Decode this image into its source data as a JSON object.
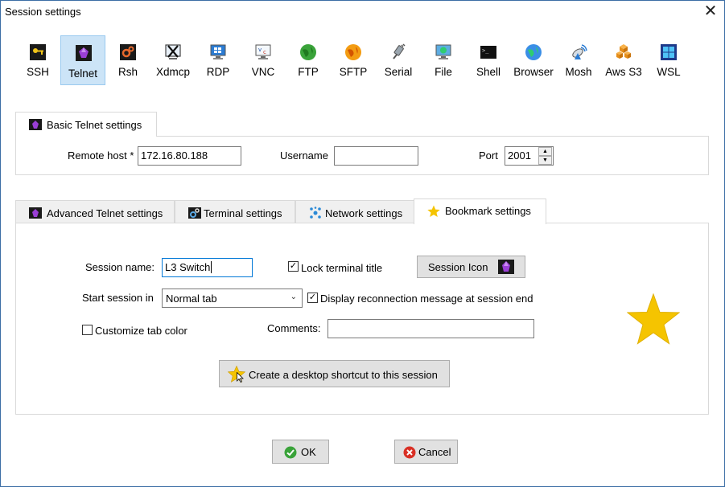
{
  "window": {
    "title": "Session settings",
    "close_glyph": "✕"
  },
  "protocols": [
    {
      "label": "SSH",
      "icon": "key-icon",
      "active": false
    },
    {
      "label": "Telnet",
      "icon": "telnet-gem-icon",
      "active": true
    },
    {
      "label": "Rsh",
      "icon": "rsh-gears-icon",
      "active": false
    },
    {
      "label": "Xdmcp",
      "icon": "xdmcp-x-icon",
      "active": false
    },
    {
      "label": "RDP",
      "icon": "rdp-monitor-icon",
      "active": false
    },
    {
      "label": "VNC",
      "icon": "vnc-monitor-icon",
      "active": false
    },
    {
      "label": "FTP",
      "icon": "ftp-globe-icon",
      "active": false
    },
    {
      "label": "SFTP",
      "icon": "sftp-globe-icon",
      "active": false
    },
    {
      "label": "Serial",
      "icon": "serial-plug-icon",
      "active": false
    },
    {
      "label": "File",
      "icon": "file-monitor-icon",
      "active": false
    },
    {
      "label": "Shell",
      "icon": "shell-terminal-icon",
      "active": false
    },
    {
      "label": "Browser",
      "icon": "browser-globe-icon",
      "active": false
    },
    {
      "label": "Mosh",
      "icon": "mosh-satellite-icon",
      "active": false
    },
    {
      "label": "Aws S3",
      "icon": "aws-cubes-icon",
      "active": false
    },
    {
      "label": "WSL",
      "icon": "windows-logo-icon",
      "active": false
    }
  ],
  "basic": {
    "tab_label": "Basic Telnet settings",
    "remote_host_label": "Remote host *",
    "remote_host_value": "172.16.80.188",
    "username_label": "Username",
    "username_value": "",
    "port_label": "Port",
    "port_value": "2001"
  },
  "tabs": [
    {
      "label": "Advanced Telnet settings",
      "selected": false
    },
    {
      "label": "Terminal settings",
      "selected": false
    },
    {
      "label": "Network settings",
      "selected": false
    },
    {
      "label": "Bookmark settings",
      "selected": true
    }
  ],
  "bookmark": {
    "session_name_label": "Session name:",
    "session_name_value": "L3 Switch",
    "lock_title_label": "Lock terminal title",
    "lock_title_checked": true,
    "session_icon_label": "Session Icon",
    "start_in_label": "Start session in",
    "start_in_value": "Normal tab",
    "reconnect_label": "Display reconnection message at session end",
    "reconnect_checked": true,
    "customize_color_label": "Customize tab color",
    "customize_color_checked": false,
    "comments_label": "Comments:",
    "comments_value": "",
    "shortcut_label": "Create a desktop shortcut to this session"
  },
  "footer": {
    "ok_label": "OK",
    "cancel_label": "Cancel"
  },
  "colors": {
    "accent": "#cce4f7",
    "star": "#f5c400",
    "telnet_gem": "#8e2ec7"
  }
}
